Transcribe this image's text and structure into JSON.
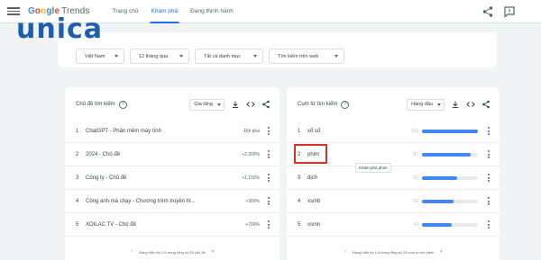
{
  "header": {
    "logo_google": [
      "G",
      "o",
      "o",
      "g",
      "l",
      "e"
    ],
    "logo_trends": "Trends",
    "nav": [
      "Trang chủ",
      "Khám phá",
      "Đang thịnh hành"
    ],
    "active_nav": 1,
    "icons": [
      "menu-icon",
      "share-icon",
      "feedback-icon"
    ]
  },
  "watermark": {
    "text": "unica"
  },
  "filters": [
    {
      "label": "Việt Nam"
    },
    {
      "label": "12 tháng qua"
    },
    {
      "label": "Tất cả danh mục"
    },
    {
      "label": "Tìm kiếm trên web"
    }
  ],
  "left_panel": {
    "title": "Chủ đề tìm kiếm",
    "sort": "Gia tăng",
    "rows": [
      {
        "num": "1",
        "label": "ChatGPT - Phần mềm máy tính",
        "value": "Đột phá"
      },
      {
        "num": "2",
        "label": "2024 - Chủ đề",
        "value": "+2.300%"
      },
      {
        "num": "3",
        "label": "Công ty - Chủ đề",
        "value": "+1.150%"
      },
      {
        "num": "4",
        "label": "Công anh mà chạy - Chương trình truyền hì...",
        "value": "+900%"
      },
      {
        "num": "5",
        "label": "XOILAC TV - Chủ đề",
        "value": "+700%"
      }
    ],
    "pager": "Đang hiển thị 1-5 trong tổng số 25 chủ đề"
  },
  "right_panel": {
    "title": "Cụm từ tìm kiếm",
    "sort": "Hàng đầu",
    "rows": [
      {
        "num": "1",
        "label": "xổ số",
        "value": 100,
        "value_text": "100"
      },
      {
        "num": "2",
        "label": "phim",
        "value": 87,
        "value_text": "87"
      },
      {
        "num": "3",
        "label": "dịch",
        "value": 63,
        "value_text": "63"
      },
      {
        "num": "4",
        "label": "xsmb",
        "value": 56,
        "value_text": "56"
      },
      {
        "num": "5",
        "label": "xsmn",
        "value": 54,
        "value_text": "54"
      }
    ],
    "pager": "Đang hiển thị 1-5 trong tổng số 25 cụm từ tìm kiếm",
    "tooltip": "Khám phá phim"
  },
  "colors": {
    "accent": "#1a73e8",
    "bar": "#4285f4",
    "highlight": "#d93025"
  }
}
